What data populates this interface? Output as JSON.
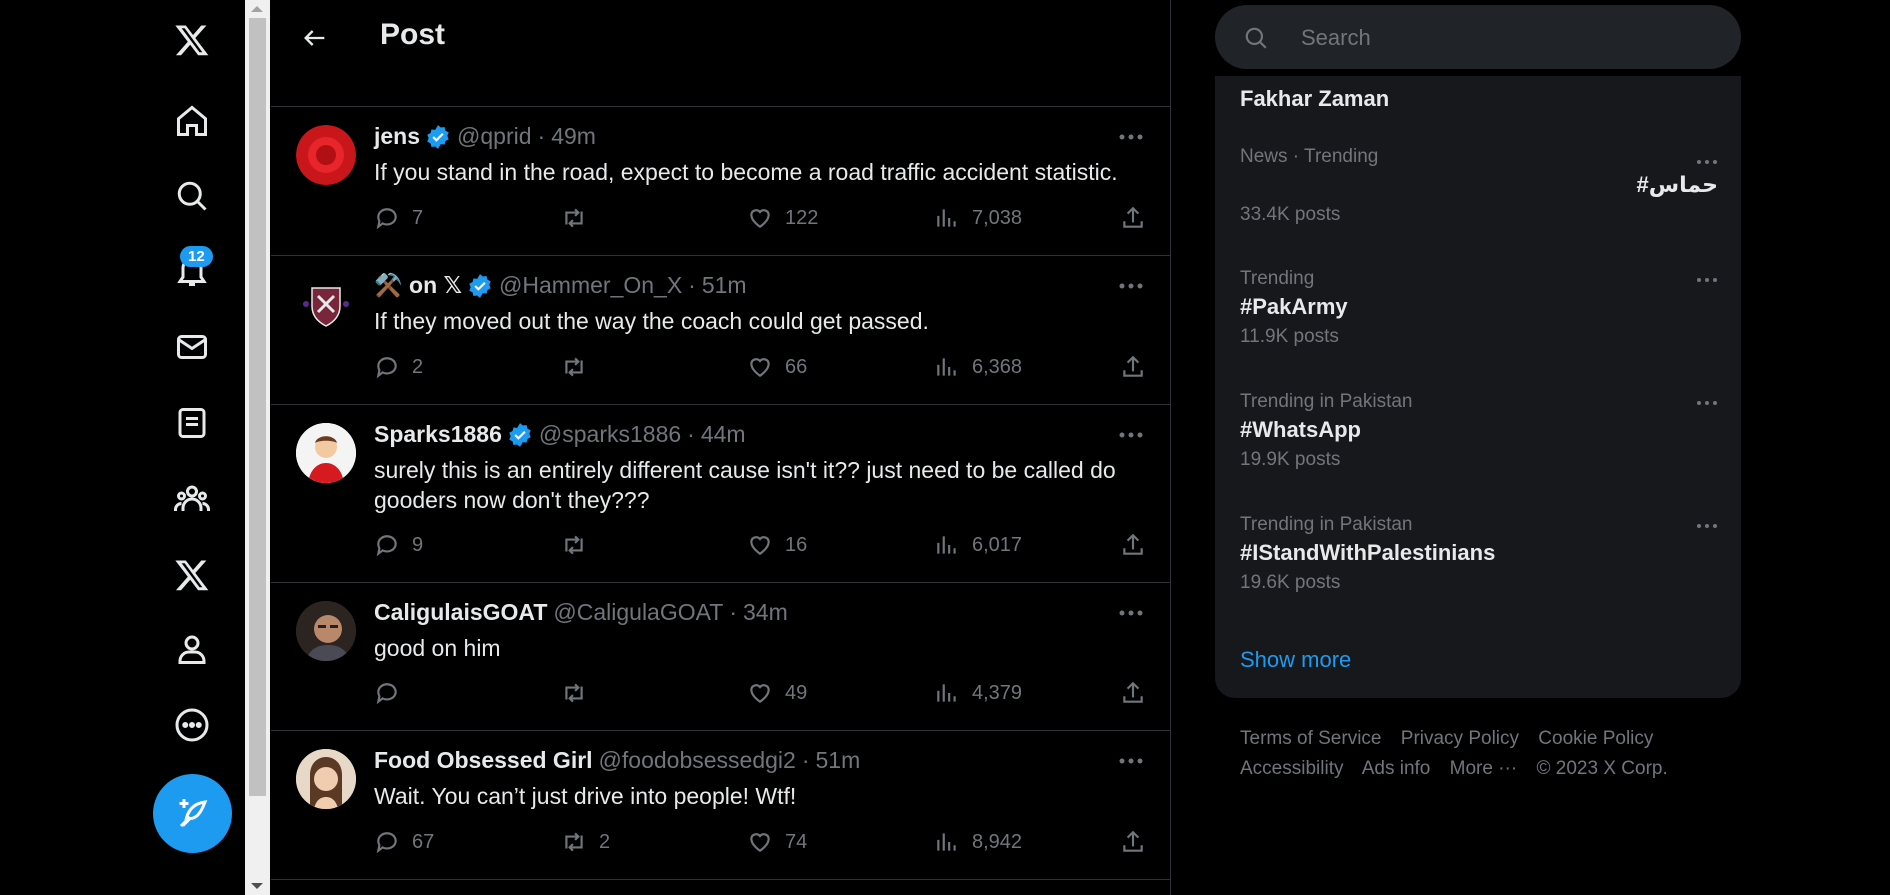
{
  "header": {
    "title": "Post"
  },
  "nav": {
    "notification_count": "12"
  },
  "tweets": [
    {
      "name": "jens",
      "handle": "@qprid",
      "time": "49m",
      "text": "If you stand in the road, expect to become a road traffic accident statistic.",
      "replies": "7",
      "retweets": "",
      "likes": "122",
      "views": "7,038",
      "verified": true
    },
    {
      "name": "⚒️ on 𝕏",
      "handle": "@Hammer_On_X",
      "time": "51m",
      "text": "If they moved out the way the coach could get passed.",
      "replies": "2",
      "retweets": "",
      "likes": "66",
      "views": "6,368",
      "verified": true
    },
    {
      "name": "Sparks1886",
      "handle": "@sparks1886",
      "time": "44m",
      "text": "surely this is an entirely different cause isn't it?? just need to be called do gooders now don't they???",
      "replies": "9",
      "retweets": "",
      "likes": "16",
      "views": "6,017",
      "verified": true
    },
    {
      "name": "CaligulaisGOAT",
      "handle": "@CaligulaGOAT",
      "time": "34m",
      "text": "good on him",
      "replies": "",
      "retweets": "",
      "likes": "49",
      "views": "4,379",
      "verified": false
    },
    {
      "name": "Food Obsessed Girl",
      "handle": "@foodobsessedgi2",
      "time": "51m",
      "text": "Wait. You can’t just drive into people! Wtf!",
      "replies": "67",
      "retweets": "2",
      "likes": "74",
      "views": "8,942",
      "verified": false
    }
  ],
  "search": {
    "placeholder": "Search"
  },
  "trends": {
    "partial_title": "Fakhar Zaman",
    "items": [
      {
        "meta": "News · Trending",
        "title": "#حماس",
        "count": "33.4K posts"
      },
      {
        "meta": "Trending",
        "title": "#PakArmy",
        "count": "11.9K posts"
      },
      {
        "meta": "Trending in Pakistan",
        "title": "#WhatsApp",
        "count": "19.9K posts"
      },
      {
        "meta": "Trending in Pakistan",
        "title": "#IStandWithPalestinians",
        "count": "19.6K posts"
      }
    ],
    "show_more": "Show more"
  },
  "footer": {
    "terms": "Terms of Service",
    "privacy": "Privacy Policy",
    "cookie": "Cookie Policy",
    "accessibility": "Accessibility",
    "ads": "Ads info",
    "more": "More ···",
    "copyright": "© 2023 X Corp."
  },
  "colors": {
    "accent": "#1d9bf0",
    "background": "#000000",
    "muted": "#71767b",
    "panel": "#16181c"
  }
}
